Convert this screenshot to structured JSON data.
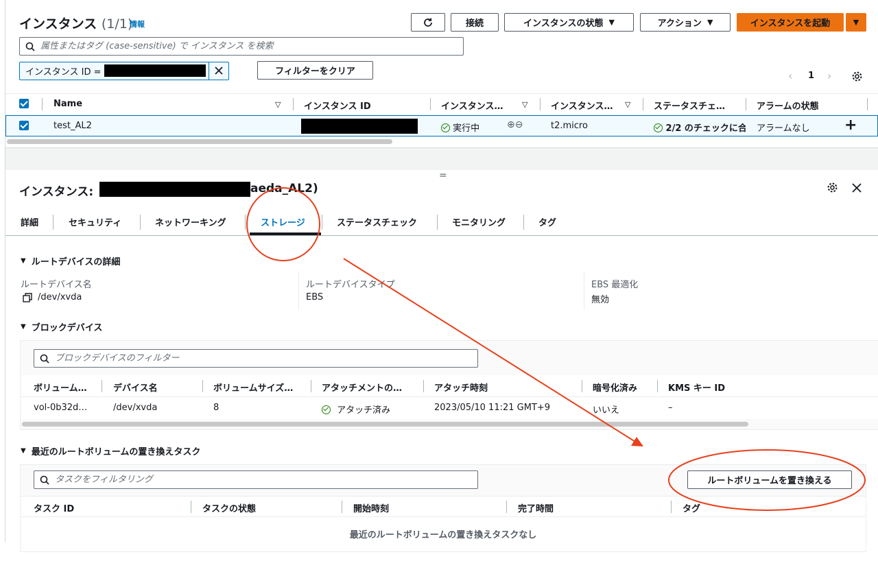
{
  "top": {
    "title": "インスタンス",
    "count": "(1/1)",
    "info": "情報",
    "buttons": {
      "connect": "接続",
      "state": "インスタンスの状態",
      "actions": "アクション",
      "launch": "インスタンスを起動"
    },
    "search_placeholder": "属性またはタグ (case-sensitive) で インスタンス を検索",
    "filter_token": "インスタンス ID =",
    "clear_filters": "フィルターをクリア",
    "page": "1"
  },
  "table": {
    "headers": [
      "Name",
      "インスタンス ID",
      "インスタンス…",
      "インスタンス…",
      "ステータスチェ…",
      "アラームの状態"
    ],
    "row": {
      "name": "test_AL2",
      "state": "実行中",
      "type": "t2.micro",
      "checks": "2/2 のチェックに合",
      "alarm": "アラームなし"
    }
  },
  "detail": {
    "title_prefix": "インスタンス:",
    "title_suffix": "aeda_AL2)",
    "tabs": [
      "詳細",
      "セキュリティ",
      "ネットワーキング",
      "ストレージ",
      "ステータスチェック",
      "モニタリング",
      "タグ"
    ],
    "active_tab": "ストレージ",
    "root": {
      "section": "ルートデバイスの詳細",
      "name_label": "ルートデバイス名",
      "name_value": "/dev/xvda",
      "type_label": "ルートデバイスタイプ",
      "type_value": "EBS",
      "ebs_label": "EBS 最適化",
      "ebs_value": "無効"
    },
    "block": {
      "section": "ブロックデバイス",
      "filter_placeholder": "ブロックデバイスのフィルター",
      "headers": [
        "ボリューム…",
        "デバイス名",
        "ボリュームサイズ…",
        "アタッチメントの…",
        "アタッチ時刻",
        "暗号化済み",
        "KMS キー ID"
      ],
      "row": {
        "volume": "vol-0b32d…",
        "device": "/dev/xvda",
        "size": "8",
        "attachment": "アタッチ済み",
        "time": "2023/05/10 11:21 GMT+9",
        "encrypted": "いいえ",
        "kms": "–"
      }
    },
    "tasks": {
      "section": "最近のルートボリュームの置き換えタスク",
      "filter_placeholder": "タスクをフィルタリング",
      "replace_button": "ルートボリュームを置き換える",
      "headers": [
        "タスク ID",
        "タスクの状態",
        "開始時刻",
        "完了時間",
        "タグ"
      ],
      "empty": "最近のルートボリュームの置き換えタスクなし"
    }
  },
  "colors": {
    "accent": "#0073bb",
    "launch": "#ec7211",
    "success": "#1d8102",
    "annotation": "#e8401c"
  }
}
